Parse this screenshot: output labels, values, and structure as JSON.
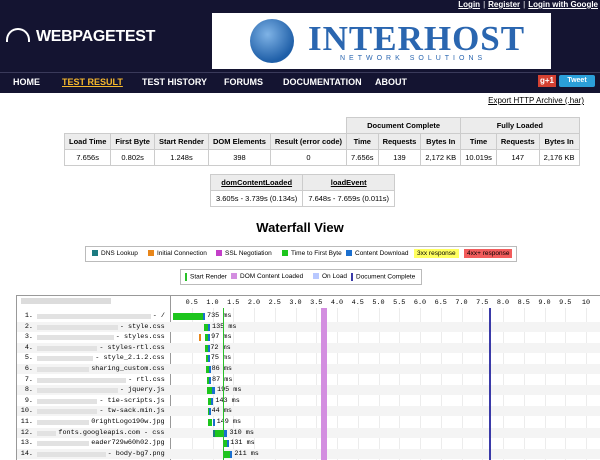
{
  "header": {
    "links": [
      "Login",
      "Register",
      "Login with Google"
    ],
    "logo": "WEBPAGETEST",
    "banner": {
      "brand": "INTERHOST",
      "tagline": "NETWORK SOLUTIONS"
    }
  },
  "nav": {
    "items": [
      "HOME",
      "TEST RESULT",
      "TEST HISTORY",
      "FORUMS",
      "DOCUMENTATION",
      "ABOUT"
    ],
    "active": "TEST RESULT",
    "gplus": "g+1",
    "tweet": "Tweet"
  },
  "export_link": "Export HTTP Archive (.har)",
  "summary": {
    "group_doc": "Document Complete",
    "group_full": "Fully Loaded",
    "headers": [
      "Load Time",
      "First Byte",
      "Start Render",
      "DOM Elements",
      "Result (error code)",
      "Time",
      "Requests",
      "Bytes In",
      "Time",
      "Requests",
      "Bytes In"
    ],
    "values": [
      "7.656s",
      "0.802s",
      "1.248s",
      "398",
      "0",
      "7.656s",
      "139",
      "2,172 KB",
      "10.019s",
      "147",
      "2,176 KB"
    ]
  },
  "events": {
    "headers": [
      "domContentLoaded",
      "loadEvent"
    ],
    "values": [
      "3.605s - 3.739s (0.134s)",
      "7.648s - 7.659s (0.011s)"
    ]
  },
  "waterfall": {
    "title": "Waterfall View",
    "legend1": [
      {
        "label": "DNS Lookup",
        "color": "#1b7a80"
      },
      {
        "label": "Initial Connection",
        "color": "#e8861a"
      },
      {
        "label": "SSL Negotiation",
        "color": "#c33ec8"
      },
      {
        "label": "Time to First Byte",
        "color": "#1dc51d"
      },
      {
        "label": "Content Download",
        "color": "#1a6fcf"
      },
      {
        "label": "3xx response",
        "color": "#ffff60"
      },
      {
        "label": "4xx+ response",
        "color": "#f25c5c"
      }
    ],
    "legend2": [
      {
        "label": "Start Render",
        "color": "#28c028"
      },
      {
        "label": "DOM Content Loaded",
        "color": "#d38ee0"
      },
      {
        "label": "On Load",
        "color": "#b8c8ff"
      },
      {
        "label": "Document Complete",
        "color": "#3a3aa8"
      }
    ],
    "ticks": [
      "0.5",
      "1.0",
      "1.5",
      "2.0",
      "2.5",
      "3.0",
      "3.5",
      "4.0",
      "4.5",
      "5.0",
      "5.5",
      "6.0",
      "6.5",
      "7.0",
      "7.5",
      "8.0",
      "8.5",
      "9.0",
      "9.5",
      "10"
    ],
    "rows": [
      {
        "n": "1.",
        "name": "- /",
        "ms": "735 ms",
        "start": 0.05,
        "ttfb": 0.72,
        "dl": 0.05,
        "dns": 0.0,
        "conn": 0.0
      },
      {
        "n": "2.",
        "name": "- style.css",
        "ms": "135 ms",
        "start": 0.8,
        "ttfb": 0.1,
        "dl": 0.04
      },
      {
        "n": "3.",
        "name": "- styles.css",
        "ms": "97 ms",
        "start": 0.82,
        "ttfb": 0.07,
        "dl": 0.03,
        "conn0": 0.02
      },
      {
        "n": "4.",
        "name": "- styles-rtl.css",
        "ms": "72 ms",
        "start": 0.83,
        "ttfb": 0.05,
        "dl": 0.02
      },
      {
        "n": "5.",
        "name": "- style_2.1.2.css",
        "ms": "75 ms",
        "start": 0.84,
        "ttfb": 0.05,
        "dl": 0.02
      },
      {
        "n": "6.",
        "name": "sharing_custom.css",
        "ms": "86 ms",
        "start": 0.85,
        "ttfb": 0.06,
        "dl": 0.02
      },
      {
        "n": "7.",
        "name": "- rtl.css",
        "ms": "87 ms",
        "start": 0.86,
        "ttfb": 0.06,
        "dl": 0.02
      },
      {
        "n": "8.",
        "name": "- jquery.js",
        "ms": "195 ms",
        "start": 0.87,
        "ttfb": 0.12,
        "dl": 0.07
      },
      {
        "n": "9.",
        "name": "- tie-scripts.js",
        "ms": "143 ms",
        "start": 0.88,
        "ttfb": 0.09,
        "dl": 0.05
      },
      {
        "n": "10.",
        "name": "- tw-sack.min.js",
        "ms": "44 ms",
        "start": 0.89,
        "ttfb": 0.03,
        "dl": 0.01
      },
      {
        "n": "11.",
        "name": "0rightLogo190w.jpg",
        "ms": "149 ms",
        "start": 0.9,
        "ttfb": 0.1,
        "dl": 0.05
      },
      {
        "n": "12.",
        "name": "fonts.googleapis.com - css",
        "ms": "310 ms",
        "start": 1.0,
        "ttfb": 0.22,
        "dl": 0.09,
        "dnsc": 0.05
      },
      {
        "n": "13.",
        "name": "eader729w60h02.jpg",
        "ms": "131 ms",
        "start": 1.25,
        "ttfb": 0.09,
        "dl": 0.04
      },
      {
        "n": "14.",
        "name": "- body-bg7.png",
        "ms": "211 ms",
        "start": 1.27,
        "ttfb": 0.14,
        "dl": 0.07
      }
    ]
  }
}
